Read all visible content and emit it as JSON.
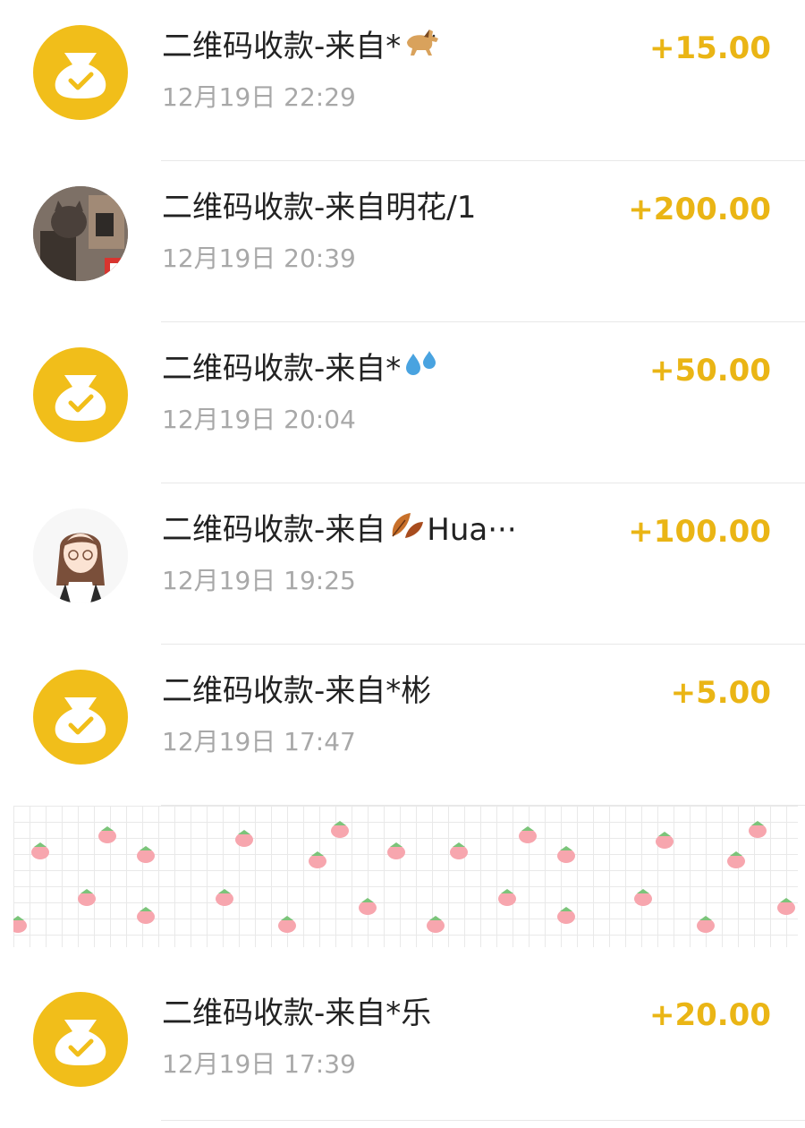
{
  "colors": {
    "accent_yellow": "#f1be1a",
    "amount_color": "#eab515",
    "title_color": "#222222",
    "time_color": "#a8a8a8",
    "divider": "#e8e8e8"
  },
  "transactions": [
    {
      "title": "二维码收款-来自*",
      "emoji": "horse-emoji",
      "time": "12月19日 22:29",
      "amount": "+15.00",
      "avatar": "money-bag-check-icon"
    },
    {
      "title": "二维码收款-来自明花/1",
      "time": "12月19日 20:39",
      "amount": "+200.00",
      "avatar": "cat-photo-avatar"
    },
    {
      "title": "二维码收款-来自*",
      "emoji": "sweat-droplets-emoji",
      "time": "12月19日 20:04",
      "amount": "+50.00",
      "avatar": "money-bag-check-icon"
    },
    {
      "title_prefix": "二维码收款-来自",
      "emoji": "fallen-leaf-emoji",
      "title_suffix": "Hua···",
      "time": "12月19日 19:25",
      "amount": "+100.00",
      "avatar": "girl-illustration-avatar"
    },
    {
      "title": "二维码收款-来自*彬",
      "time": "12月19日 17:47",
      "amount": "+5.00",
      "avatar": "money-bag-check-icon"
    },
    {
      "title": "二维码收款-来自*乐",
      "time": "12月19日 17:39",
      "amount": "+20.00",
      "avatar": "money-bag-check-icon"
    }
  ],
  "redacted_overlay": {
    "pattern": "strawberry-grid-sticker"
  }
}
